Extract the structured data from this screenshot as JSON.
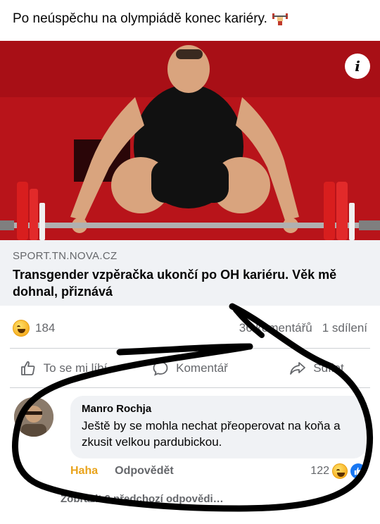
{
  "post": {
    "text": "Po neúspěchu na olympiádě konec kariéry.",
    "emoji": "weight-lifter-emoji"
  },
  "link": {
    "domain": "SPORT.TN.NOVA.CZ",
    "title": "Transgender vzpěračka ukončí po OH kariéru. Věk mě dohnal, přiznává",
    "info_icon": "i"
  },
  "reactions": {
    "count": "184",
    "comments": "36 komentářů",
    "shares": "1 sdílení"
  },
  "actions": {
    "like": "To se mi líbí",
    "comment": "Komentář",
    "share": "Sdílet"
  },
  "comment": {
    "author": "Manro Rochja",
    "text": "Ještě by se mohla nechat přeoperovat na koňa a zkusit velkou pardubickou.",
    "reaction_label": "Haha",
    "reply_label": "Odpovědět",
    "reaction_count": "122"
  },
  "more_replies": "Zobrazit 2 předchozí odpovědi…",
  "colors": {
    "photo_bg": "#b8141a",
    "link_bg": "#f0f2f5",
    "muted_text": "#65676b",
    "haha": "#e9a31b",
    "like_blue": "#1877f2"
  }
}
